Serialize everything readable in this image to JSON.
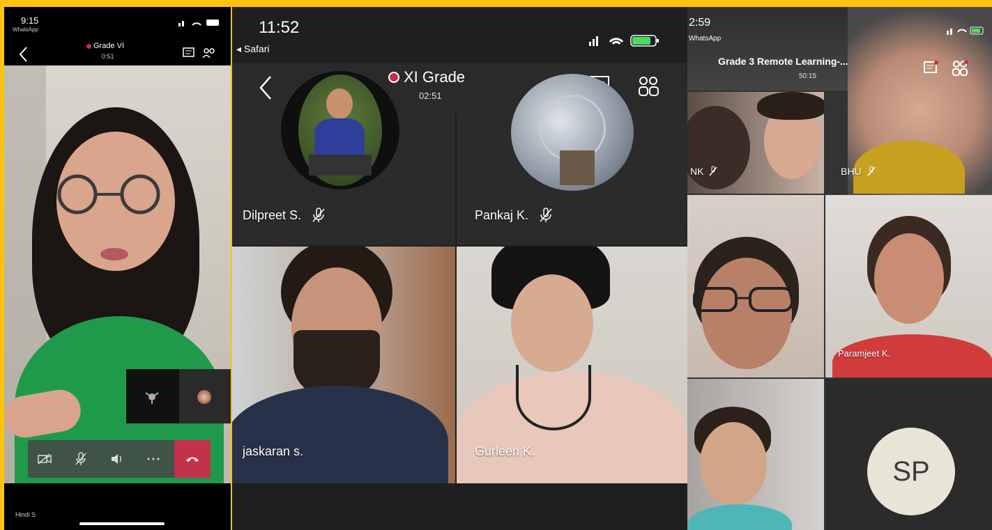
{
  "panel1": {
    "time": "9:15",
    "carrier": "WhatsApp",
    "meeting_title": "Grade VI",
    "timer": "0:51",
    "bottom_text": "Hindi S",
    "controls": [
      "video-off-icon",
      "mic-off-icon",
      "speaker-icon",
      "more-icon",
      "hangup-icon"
    ]
  },
  "panel2": {
    "time": "11:52",
    "back_app": "◂ Safari",
    "meeting_title": "XI Grade",
    "timer": "02:51",
    "participants": [
      {
        "name": "Dilpreet S."
      },
      {
        "name": "Pankaj K."
      },
      {
        "name": "jaskaran s."
      },
      {
        "name": "Gurleen K."
      }
    ]
  },
  "panel3": {
    "time": "2:59",
    "carrier": "WhatsApp",
    "meeting_title": "Grade 3 Remote Learning-...",
    "timer": "50:15",
    "participants": [
      {
        "name": "NK"
      },
      {
        "name": "BHU"
      },
      {
        "name": ""
      },
      {
        "name": "Paramjeet K."
      },
      {
        "name": ""
      },
      {
        "initials": "SP"
      }
    ]
  },
  "colors": {
    "frame": "#ffc20e",
    "dark": "#1f1f1f",
    "hangup": "#c4314b",
    "avatar_bg": "#e8e5d6"
  }
}
